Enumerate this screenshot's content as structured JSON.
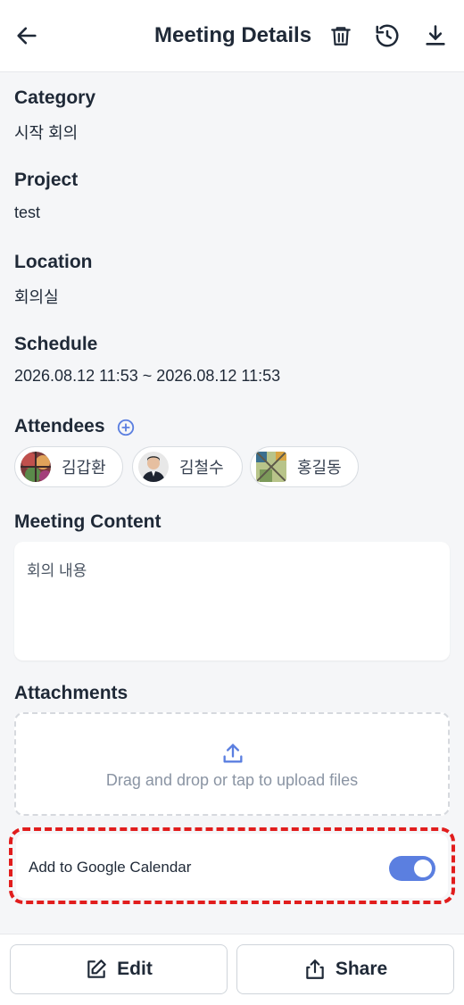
{
  "header": {
    "title": "Meeting Details",
    "icons": [
      "back-arrow-icon",
      "trash-icon",
      "history-icon",
      "download-icon"
    ]
  },
  "fields": {
    "category": {
      "label": "Category",
      "value": "시작 회의"
    },
    "project": {
      "label": "Project",
      "value": "test"
    },
    "location": {
      "label": "Location",
      "value": "회의실"
    },
    "schedule": {
      "label": "Schedule",
      "value": "2026.08.12 11:53 ~ 2026.08.12 11:53"
    }
  },
  "attendees": {
    "label": "Attendees",
    "people": [
      {
        "name": "김갑환"
      },
      {
        "name": "김철수"
      },
      {
        "name": "홍길동"
      }
    ]
  },
  "meeting_content": {
    "label": "Meeting Content",
    "value": "회의 내용"
  },
  "attachments": {
    "label": "Attachments",
    "upload_text": "Drag and drop or tap to upload files"
  },
  "google_calendar": {
    "label": "Add to Google Calendar",
    "enabled": true
  },
  "footer": {
    "edit_label": "Edit",
    "share_label": "Share"
  },
  "colors": {
    "accent": "#5b7fe0",
    "highlight_outline": "#e11d1d",
    "page_bg": "#f5f6f8"
  }
}
